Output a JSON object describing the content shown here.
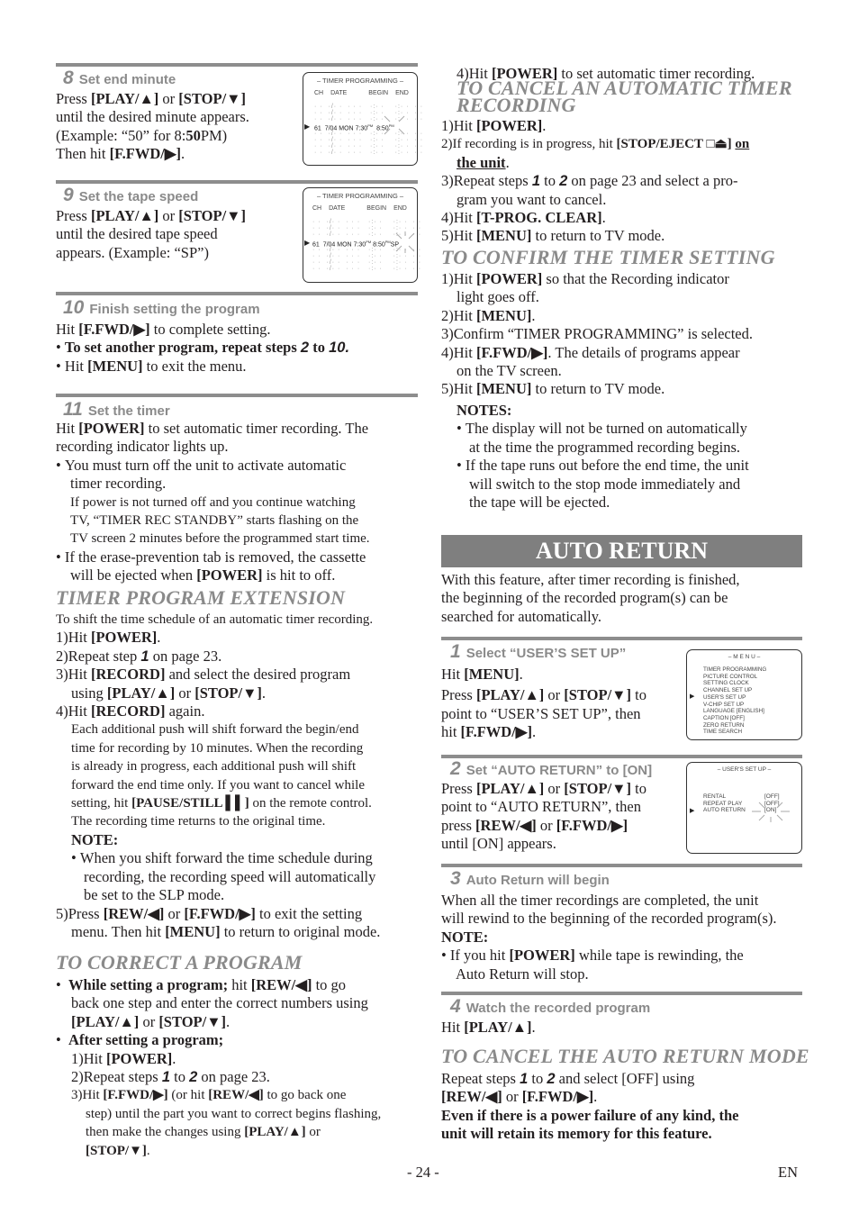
{
  "left": {
    "step8": {
      "num": "8",
      "label": "Set end minute",
      "l1a": "Press ",
      "l1b": "[PLAY/▲]",
      "l1c": " or ",
      "l1d": "[STOP/▼]",
      "l2": "until the desired minute appears.",
      "l3a": "(Example: “50” for 8:",
      "l3b": "50",
      "l3c": "PM)",
      "l4a": "Then hit ",
      "l4b": "[F.FWD/▶]",
      "l4c": "."
    },
    "screen8": {
      "title": "– TIMER PROGRAMMING –",
      "headers": [
        "CH",
        "DATE",
        "BEGIN",
        "END"
      ],
      "selected_row": {
        "ch": "61",
        "date": "7/04",
        "day": "MON",
        "begin": "7:30",
        "begin_suffix": "PM",
        "end": "8:50",
        "end_suffix": "PM"
      }
    },
    "step9": {
      "num": "9",
      "label": "Set the tape speed",
      "l1a": "Press ",
      "l1b": "[PLAY/▲]",
      "l1c": " or ",
      "l1d": "[STOP/▼]",
      "l2": "until the desired tape speed",
      "l3": "appears. (Example: “SP”)"
    },
    "screen9": {
      "title": "– TIMER PROGRAMMING –",
      "headers": [
        "CH",
        "DATE",
        "BEGIN",
        "END"
      ],
      "selected_row": {
        "ch": "61",
        "date": "7/04",
        "day": "MON",
        "begin": "7:30",
        "begin_suffix": "PM",
        "end": "8:50",
        "end_suffix": "PM",
        "speed": "SP"
      }
    },
    "step10": {
      "num": "10",
      "label": "Finish setting the program",
      "l1a": "Hit ",
      "l1b": "[F.FWD/▶]",
      "l1c": " to complete setting.",
      "b1a": "To set another program, repeat steps ",
      "b1b": "2",
      "b1c": " to ",
      "b1d": "10.",
      "b2a": "Hit ",
      "b2b": "[MENU]",
      "b2c": " to exit the menu."
    },
    "step11": {
      "num": "11",
      "label": "Set the timer",
      "l1a": "Hit ",
      "l1b": "[POWER]",
      "l1c": " to set automatic timer recording. The",
      "l2": "recording indicator lights up.",
      "b1_1": "You must turn off the unit to activate automatic",
      "b1_2": "timer recording.",
      "b1_3": "If power is not turned off and you continue watching",
      "b1_4": "TV, “TIMER REC STANDBY” starts flashing on the",
      "b1_5": "TV screen 2 minutes before the programmed start time.",
      "b2_1": "If the erase-prevention tab is removed, the cassette",
      "b2_2a": "will be ejected when ",
      "b2_2b": "[POWER]",
      "b2_2c": " is hit to off."
    },
    "extension": {
      "heading": "TIMER PROGRAM EXTENSION",
      "intro": "To shift the time schedule of an automatic timer recording.",
      "s1a": "1)Hit ",
      "s1b": "[POWER]",
      "s1c": ".",
      "s2a": "2)Repeat step ",
      "s2b": "1",
      "s2c": " on page 23.",
      "s3a": "3)Hit ",
      "s3b": "[RECORD]",
      "s3c": " and select the desired program",
      "s3d": "using ",
      "s3e": "[PLAY/▲]",
      "s3f": " or ",
      "s3g": "[STOP/▼]",
      "s3h": ".",
      "s4a": "4)Hit ",
      "s4b": "[RECORD]",
      "s4c": " again.",
      "p1": "Each additional push will shift forward the begin/end",
      "p2": "time for recording by 10 minutes. When the recording",
      "p3": "is already in progress, each additional push will shift",
      "p4": "forward the end time only. If you want to cancel while",
      "p5a": "setting, hit ",
      "p5b": "[PAUSE/STILL ▌▌]",
      "p5c": " on the remote control.",
      "p6": "The recording time returns to the original time.",
      "note": "NOTE:",
      "n1": "When you shift forward the time schedule during",
      "n2": "recording, the recording speed will automatically",
      "n3": "be set to the SLP mode.",
      "s5a": "5)Press ",
      "s5b": "[REW/◀]",
      "s5c": " or ",
      "s5d": "[F.FWD/▶]",
      "s5e": " to exit the setting",
      "s5f": "menu. Then hit ",
      "s5g": "[MENU]",
      "s5h": " to return to original mode."
    },
    "correct": {
      "heading": "TO CORRECT A PROGRAM",
      "b1a": "While setting a program;",
      "b1b": " hit ",
      "b1c": "[REW/◀]",
      "b1d": " to go",
      "b1e": "back one step and enter the correct numbers using",
      "b1f": "[PLAY/▲]",
      "b1g": " or ",
      "b1h": "[STOP/▼]",
      "b1i": ".",
      "b2": "After setting a program;",
      "c1a": "1)Hit ",
      "c1b": "[POWER]",
      "c1c": ".",
      "c2a": "2)Repeat steps ",
      "c2b": "1",
      "c2c": " to ",
      "c2d": "2",
      "c2e": " on page 23.",
      "c3a": "3)Hit ",
      "c3b": "[F.FWD/▶]",
      "c3c": " (or hit ",
      "c3d": "[REW/◀]",
      "c3e": " to go back one",
      "c3f": "step) until the part you want to correct begins flashing,",
      "c3g": "then make the changes using ",
      "c3h": "[PLAY/▲]",
      "c3i": " or",
      "c3j": "[STOP/▼]",
      "c3k": "."
    }
  },
  "right": {
    "cont": {
      "a": "4)Hit ",
      "b": "[POWER]",
      "c": " to set automatic timer recording."
    },
    "cancel": {
      "heading1": "TO CANCEL AN AUTOMATIC TIMER",
      "heading2": "RECORDING",
      "s1a": "1)Hit ",
      "s1b": "[POWER]",
      "s1c": ".",
      "s2a": "2)If recording is in progress, hit ",
      "s2b": "[STOP/EJECT □⏏]",
      "s2c": "on",
      "s2d": "the unit",
      "s2e": ".",
      "s3a": "3)Repeat steps ",
      "s3b": "1",
      "s3c": " to ",
      "s3d": "2",
      "s3e": " on page 23 and select a pro-",
      "s3f": "gram you want to cancel.",
      "s4a": "4)Hit ",
      "s4b": "[T-PROG. CLEAR]",
      "s4c": ".",
      "s5a": "5)Hit ",
      "s5b": "[MENU]",
      "s5c": " to return to TV mode."
    },
    "confirm": {
      "heading": "TO CONFIRM THE TIMER SETTING",
      "s1a": "1)Hit ",
      "s1b": "[POWER]",
      "s1c": " so that the Recording indicator",
      "s1d": "light goes off.",
      "s2a": "2)Hit ",
      "s2b": "[MENU]",
      "s2c": ".",
      "s3": "3)Confirm “TIMER PROGRAMMING” is selected.",
      "s4a": "4)Hit ",
      "s4b": "[F.FWD/▶]",
      "s4c": ". The details of programs appear",
      "s4d": "on the TV screen.",
      "s5a": "5)Hit ",
      "s5b": "[MENU]",
      "s5c": " to return to TV mode.",
      "notes": "NOTES:",
      "n1a": "The display will not be turned on automatically",
      "n1b": "at the time the programmed recording begins.",
      "n2a": "If the tape runs out before the end time, the unit",
      "n2b": "will switch to the stop mode immediately and",
      "n2c": "the tape will be ejected."
    },
    "auto_return": {
      "banner": "AUTO RETURN",
      "i1": "With this feature, after timer recording is finished,",
      "i2": "the beginning of the recorded program(s) can be",
      "i3": "searched for automatically.",
      "step1": {
        "num": "1",
        "label": "Select “USER’S SET UP”",
        "l1a": "Hit ",
        "l1b": "[MENU]",
        "l1c": ".",
        "l2a": "Press ",
        "l2b": "[PLAY/▲]",
        "l2c": " or ",
        "l2d": "[STOP/▼]",
        "l2e": " to",
        "l3": "point to “USER’S SET UP”, then",
        "l4a": "hit ",
        "l4b": "[F.FWD/▶]",
        "l4c": "."
      },
      "menu_screen": {
        "title": "– M E N U –",
        "items": [
          "TIMER PROGRAMMING",
          "PICTURE CONTROL",
          "SETTING CLOCK",
          "CHANNEL SET UP",
          "USER'S SET UP",
          "V-CHIP SET UP",
          "LANGUAGE  [ENGLISH]",
          "CAPTION  [OFF]",
          "ZERO RETURN",
          "TIME SEARCH"
        ],
        "selected": "USER'S SET UP"
      },
      "step2": {
        "num": "2",
        "label": "Set “AUTO RETURN” to [ON]",
        "l1a": "Press ",
        "l1b": "[PLAY/▲]",
        "l1c": " or ",
        "l1d": "[STOP/▼]",
        "l1e": " to",
        "l2": "point to “AUTO RETURN”, then",
        "l3a": "press ",
        "l3b": "[REW/◀]",
        "l3c": " or ",
        "l3d": "[F.FWD/▶]",
        "l4": "until [ON] appears."
      },
      "user_screen": {
        "title": "– USER'S SET UP –",
        "items": [
          {
            "label": "RENTAL",
            "value": "[OFF]"
          },
          {
            "label": "REPEAT PLAY",
            "value": "[OFF]"
          },
          {
            "label": "AUTO RETURN",
            "value": "[ON]"
          }
        ],
        "selected": "AUTO RETURN"
      },
      "step3": {
        "num": "3",
        "label": "Auto Return will begin",
        "l1": "When all the timer recordings are completed, the unit",
        "l2": "will rewind to the beginning of the recorded program(s).",
        "note": "NOTE:",
        "b1a": "If you hit ",
        "b1b": "[POWER]",
        "b1c": " while tape is rewinding, the",
        "b1d": "Auto Return will stop."
      },
      "step4": {
        "num": "4",
        "label": "Watch the recorded program",
        "l1a": "Hit ",
        "l1b": "[PLAY/▲]",
        "l1c": "."
      },
      "cancel": {
        "heading": "TO CANCEL THE AUTO RETURN MODE",
        "l1a": "Repeat steps ",
        "l1b": "1",
        "l1c": " to ",
        "l1d": "2",
        "l1e": " and select [OFF] using",
        "l2a": "[REW/◀]",
        "l2b": " or ",
        "l2c": "[F.FWD/▶]",
        "l2d": ".",
        "bold1": "Even if there is a power failure of any kind, the",
        "bold2": "unit will retain its memory for this feature."
      }
    }
  },
  "footer": {
    "page": "- 24 -",
    "lang": "EN"
  }
}
